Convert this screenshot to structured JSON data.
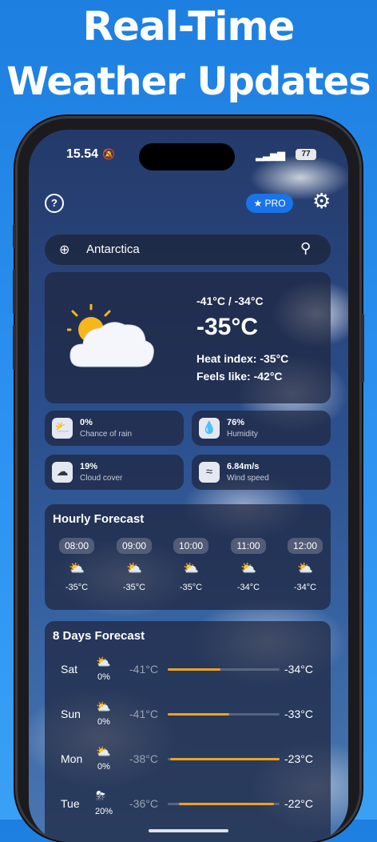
{
  "headline": {
    "line1": "Real-Time",
    "line2": "Weather Updates"
  },
  "status_bar": {
    "time": "15.54",
    "battery": "77"
  },
  "toolbar": {
    "help": "?",
    "pro_label": "PRO",
    "pro_icon": "★"
  },
  "search": {
    "location": "Antarctica"
  },
  "current": {
    "min_max": "-41°C / -34°C",
    "temperature": "-35°C",
    "heat_index": "Heat index: -35°C",
    "feels_like": "Feels like: -42°C"
  },
  "stats": [
    {
      "value": "0%",
      "label": "Chance of rain",
      "icon": "rain-cloud-icon"
    },
    {
      "value": "76%",
      "label": "Humidity",
      "icon": "water-drop-icon"
    },
    {
      "value": "19%",
      "label": "Cloud cover",
      "icon": "cloud-icon"
    },
    {
      "value": "6.84m/s",
      "label": "Wind speed",
      "icon": "wind-icon"
    }
  ],
  "hourly": {
    "title": "Hourly Forecast",
    "items": [
      {
        "time": "08:00",
        "temp": "-35°C"
      },
      {
        "time": "09:00",
        "temp": "-35°C"
      },
      {
        "time": "10:00",
        "temp": "-35°C"
      },
      {
        "time": "11:00",
        "temp": "-34°C"
      },
      {
        "time": "12:00",
        "temp": "-34°C"
      }
    ]
  },
  "daily": {
    "title": "8 Days Forecast",
    "days": [
      {
        "day": "Sat",
        "precip": "0%",
        "low": "-41°C",
        "high": "-34°C",
        "range_start": 0.0,
        "range_end": 0.47
      },
      {
        "day": "Sun",
        "precip": "0%",
        "low": "-41°C",
        "high": "-33°C",
        "range_start": 0.0,
        "range_end": 0.55
      },
      {
        "day": "Mon",
        "precip": "0%",
        "low": "-38°C",
        "high": "-23°C",
        "range_start": 0.02,
        "range_end": 1.0
      },
      {
        "day": "Tue",
        "precip": "20%",
        "low": "-36°C",
        "high": "-22°C",
        "range_start": 0.1,
        "range_end": 0.95
      }
    ]
  },
  "colors": {
    "accent": "#1a73e8",
    "range_bar": "#f2a21a"
  }
}
